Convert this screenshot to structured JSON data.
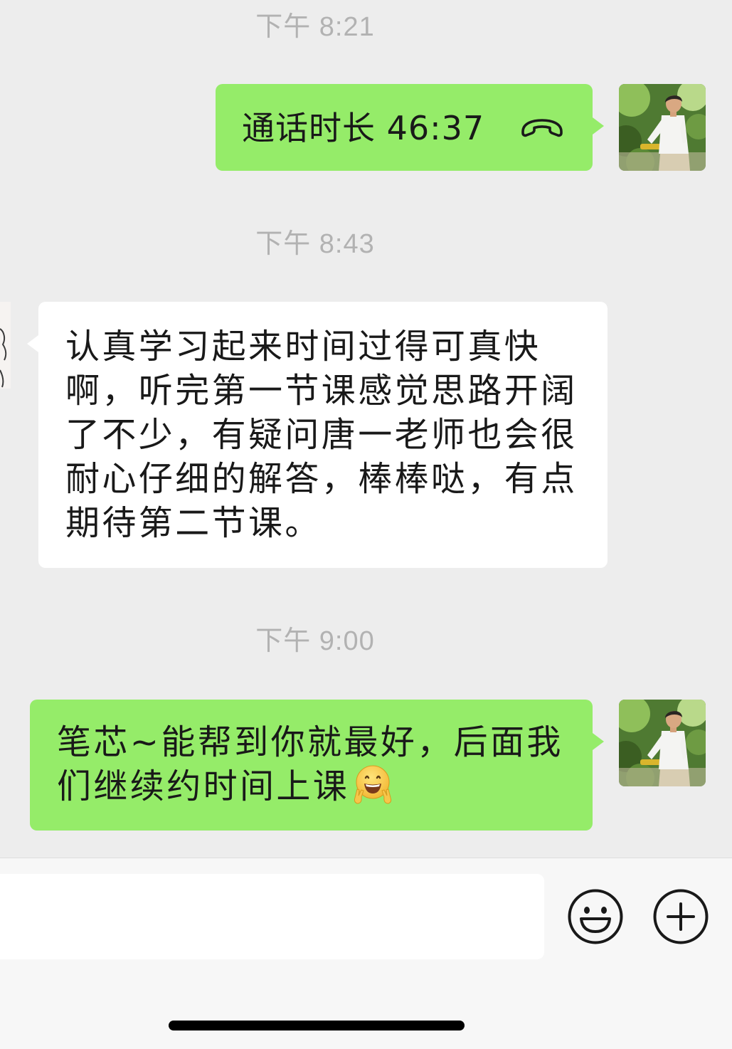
{
  "chat": {
    "timestamps": [
      "下午 8:21",
      "下午 8:43",
      "下午 9:00"
    ],
    "call_record": {
      "text": "通话时长 46:37",
      "icon": "phone-hangup-icon"
    },
    "incoming_message": {
      "lines": [
        "认真学习起来时间过得可真快",
        "啊，听完第一节课感觉思路开阔",
        "了不少，有疑问唐一老师也会很",
        "耐心仔细的解答，棒棒哒，有点",
        "期待第二节课。"
      ]
    },
    "outgoing_message": {
      "lines": [
        "笔芯~能帮到你就最好，后面我",
        "们继续约时间上课"
      ],
      "emoji": "grinning-peace-hands-emoji"
    }
  },
  "composer": {
    "input_value": "",
    "emoji_button_icon": "smiley-icon",
    "more_button_icon": "plus-circle-icon"
  },
  "colors": {
    "background": "#ededed",
    "outgoing_bubble": "#95ec69",
    "incoming_bubble": "#ffffff",
    "timestamp_text": "#b2b2b2",
    "text": "#191919",
    "composer_background": "#f7f7f7"
  }
}
